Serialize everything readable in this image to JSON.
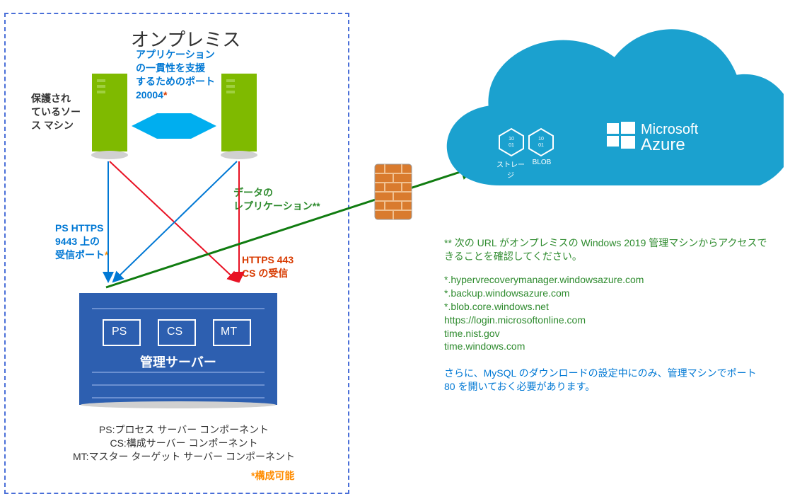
{
  "onprem": {
    "title": "オンプレミス",
    "protected_label": "保護され\nているソー\nス マシン",
    "port20004_line1": "アプリケーション",
    "port20004_line2": "の一貫性を支援",
    "port20004_line3": "するためのポート",
    "port20004_line4": "20004",
    "port20004_asterisk": "*",
    "data_repl_line1": "データの",
    "data_repl_line2": "レプリケーション**",
    "ps_port_line1": "PS HTTPS",
    "ps_port_line2": "9443 上の",
    "ps_port_line3": "受信ポート",
    "ps_port_asterisk": "*",
    "https443_line1": "HTTPS 443",
    "https443_line2": "CS の受信",
    "mgmt_server_label": "管理サーバー",
    "box_ps": "PS",
    "box_cs": "CS",
    "box_mt": "MT",
    "legend_ps": "PS:プロセス サーバー コンポーネント",
    "legend_cs": "CS:構成サーバー コンポーネント",
    "legend_mt": "MT:マスター ターゲット サーバー コンポーネント",
    "configurable": "*構成可能"
  },
  "cloud": {
    "storage_label": "ストレージ",
    "blob_label": "BLOB",
    "azure_brand1": "Microsoft",
    "azure_brand2": "Azure"
  },
  "notes": {
    "url_intro": "** 次の URL がオンプレミスの Windows 2019 管理マシンからアクセスできることを確認してください。",
    "url1": "*.hypervrecoverymanager.windowsazure.com",
    "url2": "*.backup.windowsazure.com",
    "url3": "*.blob.core.windows.net",
    "url4": "https://login.microsoftonline.com",
    "url5": "time.nist.gov",
    "url6": "time.windows.com",
    "mysql_note": "さらに、MySQL のダウンロードの設定中にのみ、管理マシンでポート 80 を開いておく必要があります。"
  }
}
